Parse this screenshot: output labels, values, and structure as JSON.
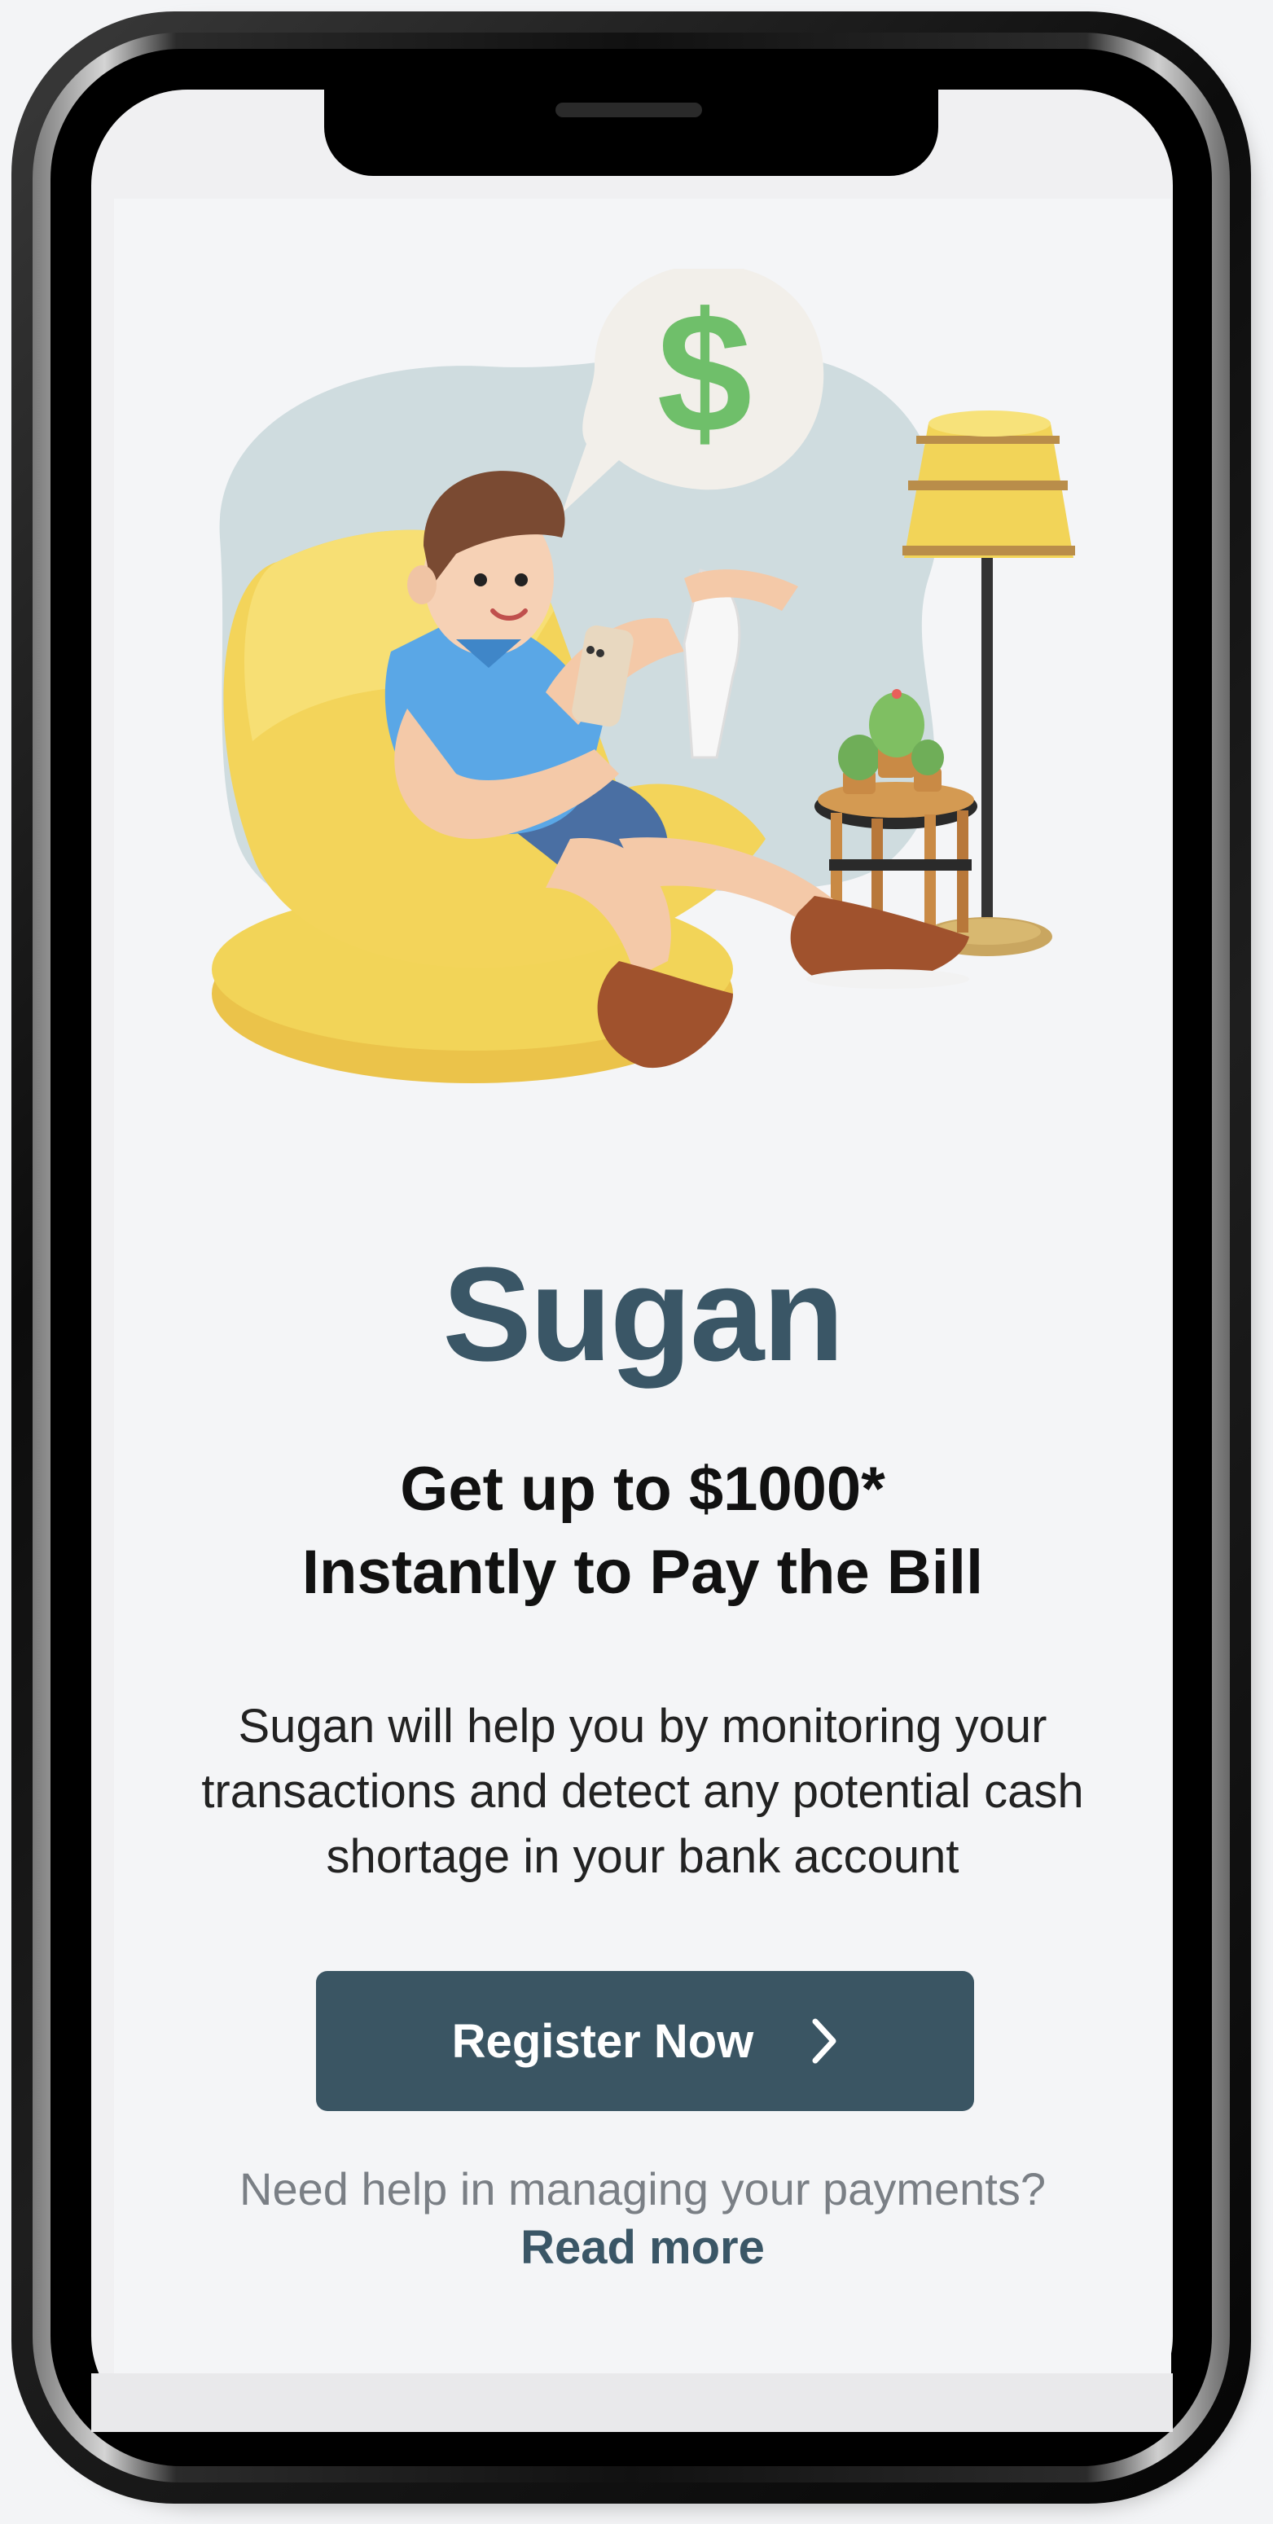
{
  "app": {
    "brand_name": "Sugan"
  },
  "hero": {
    "illustration_icon": "man-in-armchair-with-phone-and-receipt-illustration",
    "speech_bubble_symbol": "$"
  },
  "headline": {
    "line1": "Get up to $1000*",
    "line2": "Instantly to Pay the Bill"
  },
  "description": {
    "line1": "Sugan will help you by monitoring your",
    "line2": "transactions and detect any potential cash",
    "line3": "shortage in your bank account"
  },
  "cta": {
    "register_label": "Register Now",
    "register_icon": "chevron-right-icon"
  },
  "footer": {
    "help_text": "Need help in managing your payments?",
    "read_more_label": "Read more"
  },
  "colors": {
    "brand": "#3a5666",
    "button_bg": "#3a5563",
    "background": "#f4f5f7",
    "accent_green": "#6fbf6a",
    "accent_yellow": "#f2d458"
  }
}
